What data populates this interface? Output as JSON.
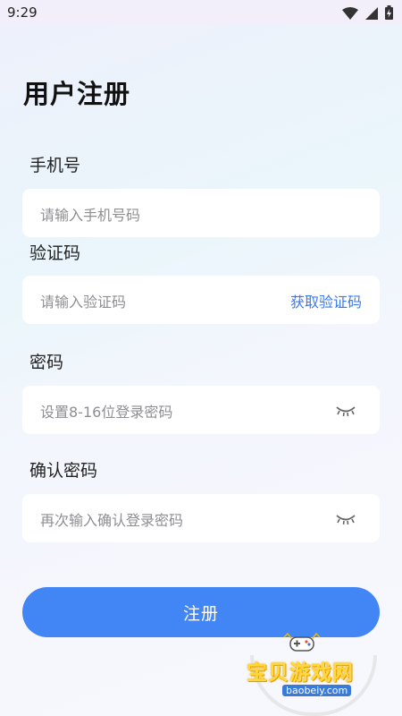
{
  "status": {
    "time": "9:29"
  },
  "page": {
    "title": "用户注册"
  },
  "form": {
    "phone": {
      "label": "手机号",
      "placeholder": "请输入手机号码"
    },
    "code": {
      "label": "验证码",
      "placeholder": "请输入验证码",
      "action": "获取验证码"
    },
    "password": {
      "label": "密码",
      "placeholder": "设置8-16位登录密码"
    },
    "confirm": {
      "label": "确认密码",
      "placeholder": "再次输入确认登录密码"
    },
    "submit_label": "注册"
  },
  "watermark": {
    "title": "宝贝游戏网",
    "url": "baobeiy.com"
  },
  "colors": {
    "accent": "#4285f4",
    "link": "#3a78f2",
    "placeholder": "#8e8e93"
  },
  "icons": {
    "wifi": "wifi-icon",
    "signal": "signal-icon",
    "battery": "battery-icon",
    "eye_closed": "eye-closed-icon",
    "gamepad": "gamepad-icon"
  }
}
